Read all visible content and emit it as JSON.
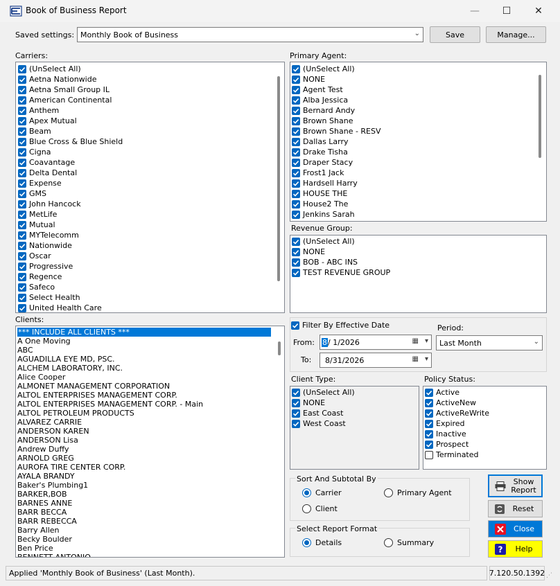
{
  "window": {
    "title": "Book of Business Report",
    "minimize_glyph": "—",
    "maximize_glyph": "☐",
    "close_glyph": "✕"
  },
  "saved_settings": {
    "label": "Saved settings:",
    "value": "Monthly Book of Business",
    "save_label": "Save",
    "manage_label": "Manage..."
  },
  "carriers": {
    "label": "Carriers:",
    "items": [
      {
        "label": "(UnSelect All)",
        "checked": true
      },
      {
        "label": "Aetna Nationwide",
        "checked": true
      },
      {
        "label": "Aetna Small Group IL",
        "checked": true
      },
      {
        "label": "American Continental",
        "checked": true
      },
      {
        "label": "Anthem",
        "checked": true
      },
      {
        "label": "Apex Mutual",
        "checked": true
      },
      {
        "label": "Beam",
        "checked": true
      },
      {
        "label": "Blue Cross & Blue Shield",
        "checked": true
      },
      {
        "label": "Cigna",
        "checked": true
      },
      {
        "label": "Coavantage",
        "checked": true
      },
      {
        "label": "Delta Dental",
        "checked": true
      },
      {
        "label": "Expense",
        "checked": true
      },
      {
        "label": "GMS",
        "checked": true
      },
      {
        "label": "John Hancock",
        "checked": true
      },
      {
        "label": "MetLife",
        "checked": true
      },
      {
        "label": "Mutual",
        "checked": true
      },
      {
        "label": "MYTelecomm",
        "checked": true
      },
      {
        "label": "Nationwide",
        "checked": true
      },
      {
        "label": "Oscar",
        "checked": true
      },
      {
        "label": "Progressive",
        "checked": true
      },
      {
        "label": "Regence",
        "checked": true
      },
      {
        "label": "Safeco",
        "checked": true
      },
      {
        "label": "Select Health",
        "checked": true
      },
      {
        "label": "United Health Care",
        "checked": true
      }
    ]
  },
  "primary_agent": {
    "label": "Primary Agent:",
    "items": [
      {
        "label": "(UnSelect All)",
        "checked": true
      },
      {
        "label": "NONE",
        "checked": true
      },
      {
        "label": "Agent Test",
        "checked": true
      },
      {
        "label": "Alba Jessica",
        "checked": true
      },
      {
        "label": "Bernard Andy",
        "checked": true
      },
      {
        "label": "Brown Shane",
        "checked": true
      },
      {
        "label": "Brown Shane - RESV",
        "checked": true
      },
      {
        "label": "Dallas Larry",
        "checked": true
      },
      {
        "label": "Drake Tisha",
        "checked": true
      },
      {
        "label": "Draper Stacy",
        "checked": true
      },
      {
        "label": "Frost1 Jack",
        "checked": true
      },
      {
        "label": "Hardsell Harry",
        "checked": true
      },
      {
        "label": "HOUSE THE",
        "checked": true
      },
      {
        "label": "House2 The",
        "checked": true
      },
      {
        "label": "Jenkins Sarah",
        "checked": true
      }
    ]
  },
  "revenue_group": {
    "label": "Revenue Group:",
    "items": [
      {
        "label": "(UnSelect All)",
        "checked": true
      },
      {
        "label": "NONE",
        "checked": true
      },
      {
        "label": "BOB - ABC INS",
        "checked": true
      },
      {
        "label": "TEST REVENUE GROUP",
        "checked": true
      }
    ]
  },
  "clients": {
    "label": "Clients:",
    "items": [
      "*** INCLUDE ALL CLIENTS ***",
      "A One Moving",
      "ABC",
      "AGUADILLA EYE MD, PSC.",
      "ALCHEM LABORATORY, INC.",
      "Alice Cooper",
      "ALMONET MANAGEMENT CORPORATION",
      "ALTOL ENTERPRISES MANAGEMENT CORP.",
      "ALTOL ENTERPRISES MANAGEMENT CORP. - Main",
      "ALTOL PETROLEUM PRODUCTS",
      "ALVAREZ CARRIE",
      "ANDERSON KAREN",
      "ANDERSON Lisa",
      "Andrew Duffy",
      "ARNOLD GREG",
      "AUROFA TIRE CENTER CORP.",
      "AYALA BRANDY",
      "Baker's Plumbing1",
      "BARKER,BOB",
      "BARNES ANNE",
      "BARR BECCA",
      "BARR REBECCA",
      "Barry Allen",
      "Becky Boulder",
      "Ben Price",
      "BENNETT ANTONIO"
    ]
  },
  "date_filter": {
    "filter_label": "Filter By Effective Date",
    "filter_checked": true,
    "from_label": "From:",
    "from_month": "8",
    "from_rest": "/  1/2026",
    "to_label": "To:",
    "to_value": "8/31/2026",
    "period_label": "Period:",
    "period_value": "Last Month"
  },
  "client_type": {
    "label": "Client Type:",
    "items": [
      {
        "label": "(UnSelect All)",
        "checked": true
      },
      {
        "label": "NONE",
        "checked": true
      },
      {
        "label": "East Coast",
        "checked": true
      },
      {
        "label": "West Coast",
        "checked": true
      }
    ]
  },
  "policy_status": {
    "label": "Policy Status:",
    "items": [
      {
        "label": "Active",
        "checked": true
      },
      {
        "label": "ActiveNew",
        "checked": true
      },
      {
        "label": "ActiveReWrite",
        "checked": true
      },
      {
        "label": "Expired",
        "checked": true
      },
      {
        "label": "Inactive",
        "checked": true
      },
      {
        "label": "Prospect",
        "checked": true
      },
      {
        "label": "Terminated",
        "checked": false
      }
    ]
  },
  "sort_subtotal": {
    "label": "Sort And Subtotal By",
    "carrier_label": "Carrier",
    "primary_agent_label": "Primary Agent",
    "client_label": "Client",
    "selected": "Carrier"
  },
  "report_format": {
    "label": "Select Report Format",
    "details_label": "Details",
    "summary_label": "Summary",
    "selected": "Details"
  },
  "actions": {
    "show_report_line1": "Show",
    "show_report_line2": "Report",
    "reset_label": "Reset",
    "close_label": "Close",
    "help_label": "Help",
    "close_color": "#0078d7",
    "help_color": "#ffff00"
  },
  "status": {
    "message": "Applied 'Monthly Book of Business' (Last Month).",
    "version": "7.120.50.1392"
  }
}
